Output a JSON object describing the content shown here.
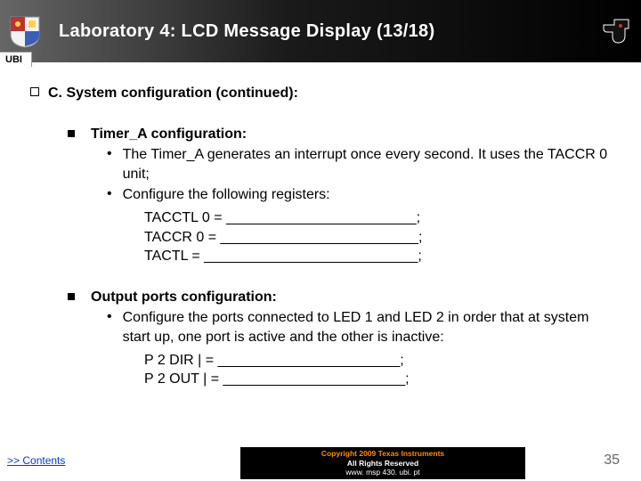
{
  "header": {
    "title": "Laboratory 4: LCD Message Display (13/18)",
    "ubi_label": "UBI"
  },
  "section": {
    "heading": "C. System configuration (continued):"
  },
  "timer_block": {
    "title": "Timer_A configuration:",
    "bullet1": "The Timer_A generates an interrupt once every second. It uses the TACCR 0 unit;",
    "bullet2": "Configure the following registers:",
    "reg1": "TACCTL 0 = ________________________;",
    "reg2": "TACCR 0 = _________________________;",
    "reg3": "TACTL = ___________________________;"
  },
  "output_block": {
    "title": "Output ports configuration:",
    "bullet1": "Configure the ports connected to LED 1 and LED 2 in order that at system start up, one port is active and the other is inactive:",
    "reg1": "P 2 DIR  | = _______________________;",
    "reg2": "P 2 OUT  | = _______________________;"
  },
  "footer": {
    "contents_link": ">> Contents",
    "copyright_line1": "Copyright  2009 Texas Instruments",
    "copyright_line2": "All Rights Reserved",
    "copyright_line3": "www. msp 430. ubi. pt",
    "page_number": "35"
  }
}
